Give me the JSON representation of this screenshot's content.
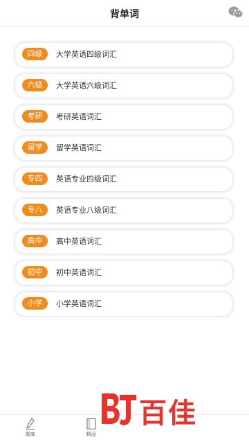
{
  "header": {
    "title": "背单词",
    "wechat_icon": "wechat-icon"
  },
  "words": [
    {
      "tag": "四级",
      "label": "大学英语四级词汇"
    },
    {
      "tag": "六级",
      "label": "大学英语六级词汇"
    },
    {
      "tag": "考研",
      "label": "考研英语词汇"
    },
    {
      "tag": "留学",
      "label": "留学英语词汇"
    },
    {
      "tag": "专四",
      "label": "英语专业四级词汇"
    },
    {
      "tag": "专八",
      "label": "英语专业八级词汇"
    },
    {
      "tag": "高中",
      "label": "高中英语词汇"
    },
    {
      "tag": "初中",
      "label": "初中英语词汇"
    },
    {
      "tag": "小学",
      "label": "小学英语词汇"
    }
  ],
  "tabs": [
    {
      "label": "题库",
      "icon": "pencil-icon"
    },
    {
      "label": "精品",
      "icon": "book-icon"
    }
  ],
  "brand": {
    "text": "百佳"
  },
  "colors": {
    "accent": "#f28a1c",
    "brand": "#e8322c"
  }
}
